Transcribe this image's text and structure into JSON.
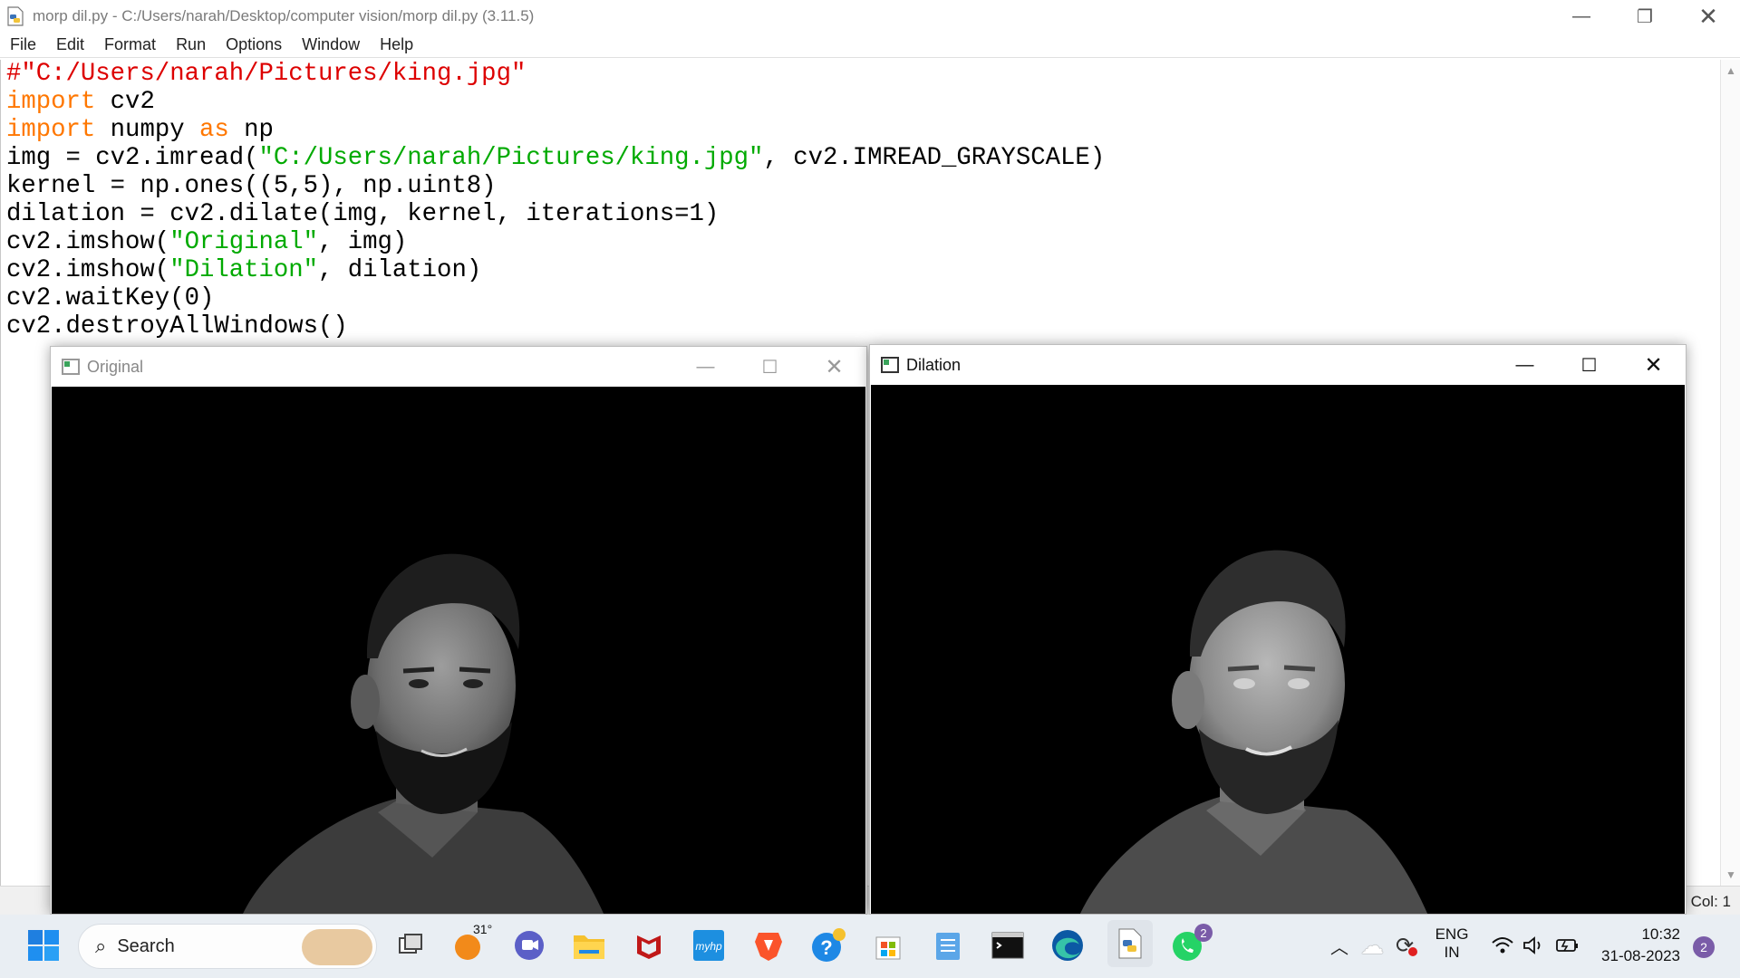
{
  "window": {
    "title": "morp dil.py - C:/Users/narah/Desktop/computer vision/morp dil.py (3.11.5)"
  },
  "menu": [
    "File",
    "Edit",
    "Format",
    "Run",
    "Options",
    "Window",
    "Help"
  ],
  "code": {
    "line1": "#\"C:/Users/narah/Pictures/king.jpg\"",
    "kw_import": "import",
    "kw_as": "as",
    "l2_rest": " cv2",
    "l3_mid": " numpy ",
    "l3_end": " np",
    "l4_a": "img = cv2.imread(",
    "l4_str": "\"C:/Users/narah/Pictures/king.jpg\"",
    "l4_b": ", cv2.IMREAD_GRAYSCALE)",
    "l5": "kernel = np.ones((5,5), np.uint8)",
    "l6": "dilation = cv2.dilate(img, kernel, iterations=1)",
    "l7_a": "cv2.imshow(",
    "l7_str": "\"Original\"",
    "l7_b": ", img)",
    "l8_a": "cv2.imshow(",
    "l8_str": "\"Dilation\"",
    "l8_b": ", dilation)",
    "l9": "cv2.waitKey(0)",
    "l10": "cv2.destroyAllWindows()"
  },
  "status": {
    "col": "Col: 1"
  },
  "windows": {
    "original": {
      "title": "Original"
    },
    "dilation": {
      "title": "Dilation"
    }
  },
  "taskbar": {
    "search_placeholder": "Search",
    "weather_temp": "31°",
    "whatsapp_badge": "2",
    "lang_top": "ENG",
    "lang_bottom": "IN",
    "time": "10:32",
    "date": "31-08-2023",
    "notif_count": "2"
  },
  "colors": {
    "comment": "#dd0000",
    "keyword": "#ff7700",
    "string": "#00aa00",
    "taskbar": "#e9eef3"
  }
}
